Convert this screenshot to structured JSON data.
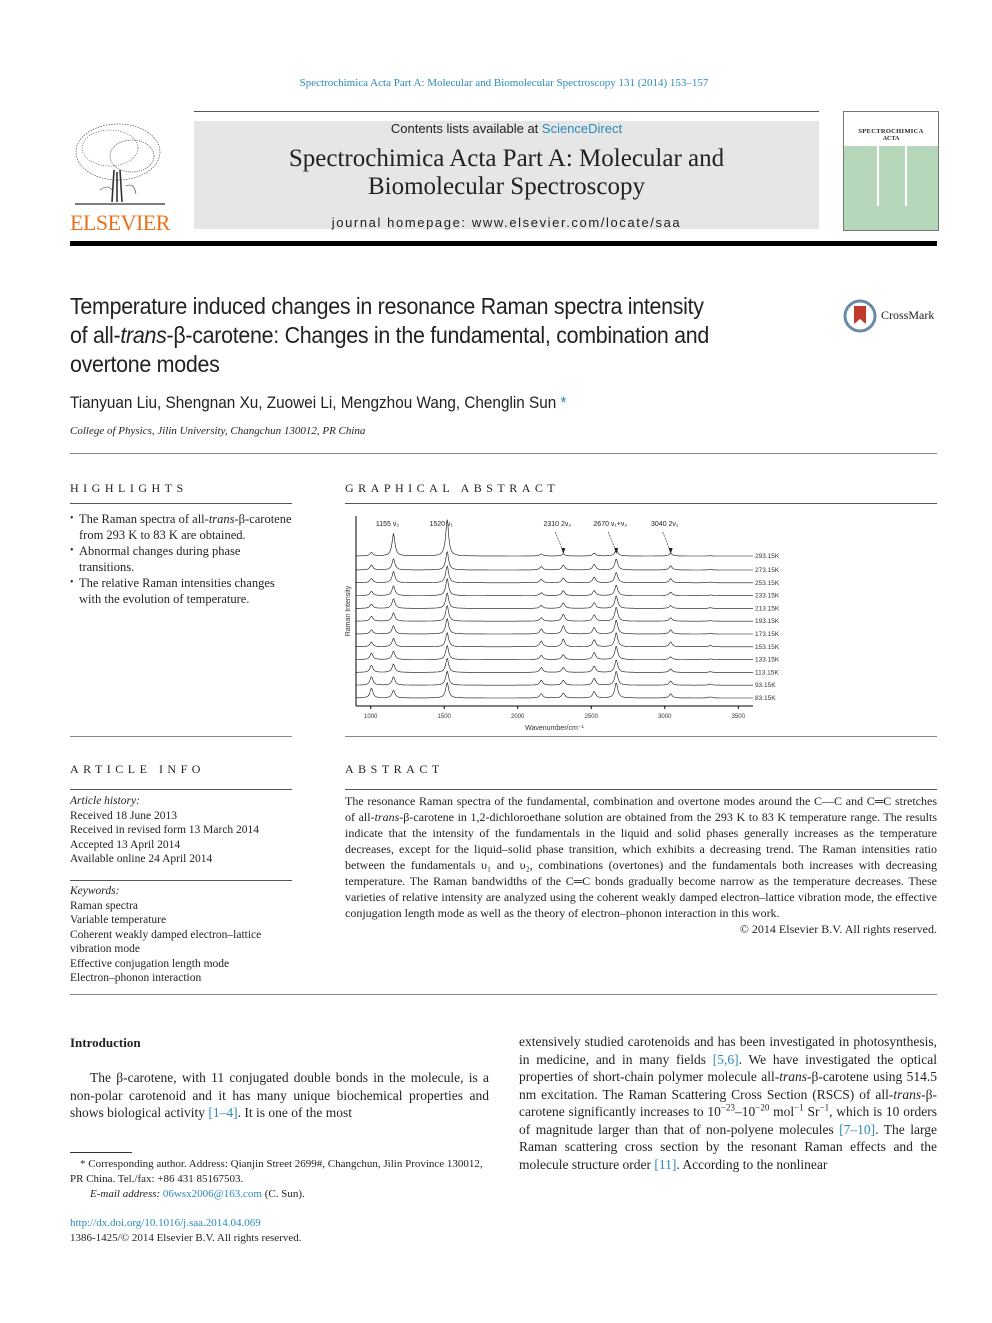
{
  "header": {
    "running_title": "Spectrochimica Acta Part A: Molecular and Biomolecular Spectroscopy 131 (2014) 153–157",
    "contents_prefix": "Contents lists available at ",
    "contents_link": "ScienceDirect",
    "journal_title_line1": "Spectrochimica Acta Part A: Molecular and",
    "journal_title_line2": "Biomolecular Spectroscopy",
    "homepage_label": "journal homepage: ",
    "homepage_url": "www.elsevier.com/locate/saa",
    "publisher_logo_text": "ELSEVIER",
    "cover_title1": "SPECTROCHIMICA",
    "cover_title2": "ACTA",
    "crossmark_label": "CrossMark"
  },
  "article": {
    "title_line1": "Temperature induced changes in resonance Raman spectra intensity",
    "title_line2_pre": "of all-",
    "title_line2_italic": "trans",
    "title_line2_post": "-β-carotene: Changes in the fundamental, combination and",
    "title_line3": "overtone modes",
    "authors": "Tianyuan Liu, Shengnan Xu, Zuowei Li, Mengzhou Wang, Chenglin Sun",
    "author_star": "*",
    "affiliation": "College of Physics, Jilin University, Changchun 130012, PR China"
  },
  "highlights": {
    "heading": "HIGHLIGHTS",
    "items": [
      {
        "pre": "The Raman spectra of all-",
        "italic": "trans",
        "post": "-β-carotene from 293 K to 83 K are obtained."
      },
      {
        "pre": "Abnormal changes during phase transitions.",
        "italic": "",
        "post": ""
      },
      {
        "pre": "The relative Raman intensities changes with the evolution of temperature.",
        "italic": "",
        "post": ""
      }
    ]
  },
  "graphical_abstract": {
    "heading": "GRAPHICAL ABSTRACT"
  },
  "chart_data": {
    "type": "line",
    "title": "",
    "xlabel": "Wavenumber/cm⁻¹",
    "ylabel": "Raman Intensity",
    "xlim": [
      900,
      3600
    ],
    "xticks": [
      1000,
      1500,
      2000,
      2500,
      3000,
      3500
    ],
    "grid": false,
    "peak_annotations": [
      {
        "x": 1155,
        "label": "1155  ν₂"
      },
      {
        "x": 1520,
        "label": "1520  ν₁"
      },
      {
        "x": 2310,
        "label": "2310  2ν₂"
      },
      {
        "x": 2670,
        "label": "2670  ν₁+ν₂"
      },
      {
        "x": 3040,
        "label": "3040  2ν₁"
      }
    ],
    "peaks": [
      1005,
      1155,
      1520,
      2160,
      2310,
      2520,
      2670,
      3040,
      3310
    ],
    "series": [
      {
        "name": "293.15K",
        "intensities": [
          0.25,
          1.6,
          2.6,
          0.15,
          0.15,
          0.2,
          0.45,
          0.2,
          0.02
        ]
      },
      {
        "name": "273.15K",
        "intensities": [
          0.35,
          0.8,
          1.3,
          0.25,
          0.35,
          0.4,
          0.8,
          0.3,
          0.05
        ]
      },
      {
        "name": "253.15K",
        "intensities": [
          0.3,
          0.8,
          1.2,
          0.25,
          0.35,
          0.4,
          0.75,
          0.3,
          0.05
        ]
      },
      {
        "name": "233.15K",
        "intensities": [
          0.3,
          0.7,
          1.2,
          0.2,
          0.35,
          0.35,
          0.75,
          0.25,
          0.05
        ]
      },
      {
        "name": "213.15K",
        "intensities": [
          0.3,
          0.7,
          1.1,
          0.2,
          0.4,
          0.4,
          0.9,
          0.2,
          0.05
        ]
      },
      {
        "name": "193.15K",
        "intensities": [
          0.35,
          0.6,
          1.1,
          0.25,
          0.5,
          0.45,
          1.0,
          0.25,
          0.05
        ]
      },
      {
        "name": "173.15K",
        "intensities": [
          0.3,
          0.6,
          1.1,
          0.35,
          0.6,
          0.45,
          1.0,
          0.3,
          0.05
        ]
      },
      {
        "name": "153.15K",
        "intensities": [
          0.35,
          0.6,
          1.0,
          0.4,
          0.55,
          0.5,
          1.0,
          0.35,
          0.1
        ]
      },
      {
        "name": "133.15K",
        "intensities": [
          0.45,
          0.6,
          1.0,
          0.3,
          0.35,
          0.5,
          0.95,
          0.2,
          0.05
        ]
      },
      {
        "name": "113.15K",
        "intensities": [
          0.5,
          0.6,
          1.0,
          0.35,
          0.35,
          0.45,
          0.9,
          0.25,
          0.05
        ]
      },
      {
        "name": "93.15K",
        "intensities": [
          0.6,
          0.6,
          1.0,
          0.35,
          0.35,
          0.5,
          1.0,
          0.3,
          0.08
        ]
      },
      {
        "name": "83.15K",
        "intensities": [
          0.7,
          0.55,
          1.1,
          0.3,
          0.35,
          0.45,
          1.1,
          0.3,
          0.08
        ]
      }
    ]
  },
  "article_info": {
    "heading": "ARTICLE INFO",
    "history_label": "Article history:",
    "history": [
      "Received 18 June 2013",
      "Received in revised form 13 March 2014",
      "Accepted 13 April 2014",
      "Available online 24 April 2014"
    ],
    "keywords_label": "Keywords:",
    "keywords": [
      "Raman spectra",
      "Variable temperature",
      "Coherent weakly damped electron–lattice vibration mode",
      "Effective conjugation length mode",
      "Electron–phonon interaction"
    ]
  },
  "abstract": {
    "heading": "ABSTRACT",
    "text": "The resonance Raman spectra of the fundamental, combination and overtone modes around the C—C and C═C stretches of all-trans-β-carotene in 1,2-dichloroethane solution are obtained from the 293 K to 83 K temperature range. The results indicate that the intensity of the fundamentals in the liquid and solid phases generally increases as the temperature decreases, except for the liquid–solid phase transition, which exhibits a decreasing trend. The Raman intensities ratio between the fundamentals υ₁ and υ₂, combinations (overtones) and the fundamentals both increases with decreasing temperature. The Raman bandwidths of the C═C bonds gradually become narrow as the temperature decreases. These varieties of relative intensity are analyzed using the coherent weakly damped electron–lattice vibration mode, the effective conjugation length mode as well as the theory of electron–phonon interaction in this work.",
    "rights": "© 2014 Elsevier B.V. All rights reserved."
  },
  "introduction": {
    "heading": "Introduction",
    "left_para": [
      {
        "t": "The β-carotene, with 11 conjugated double bonds in the molecule, is a non-polar carotenoid and it has many unique biochemical properties and shows biological activity "
      },
      {
        "ref": "[1–4]"
      },
      {
        "t": ". It is one of the most"
      }
    ],
    "right_para": [
      {
        "t": "extensively studied carotenoids and has been investigated in photosynthesis, in medicine, and in many fields "
      },
      {
        "ref": "[5,6]"
      },
      {
        "t": ". We have investigated the optical properties of short-chain polymer molecule all-"
      },
      {
        "i": "trans"
      },
      {
        "t": "-β-carotene using 514.5 nm excitation. The Raman Scattering Cross Section (RSCS) of all-"
      },
      {
        "i": "trans"
      },
      {
        "t": "-β-carotene significantly increases to 10"
      },
      {
        "sup": "−23"
      },
      {
        "t": "–10"
      },
      {
        "sup": "−20"
      },
      {
        "t": " mol"
      },
      {
        "sup": "−1"
      },
      {
        "t": " Sr"
      },
      {
        "sup": "−1"
      },
      {
        "t": ", which is 10 orders of magnitude larger than that of non-polyene molecules "
      },
      {
        "ref": "[7–10]"
      },
      {
        "t": ". The large Raman scattering cross section by the resonant Raman effects and the molecule structure order "
      },
      {
        "ref": "[11]"
      },
      {
        "t": ". According to the nonlinear"
      }
    ]
  },
  "footnotes": {
    "corresponding": "* Corresponding author. Address: Qianjin Street 2699#, Changchun, Jilin Province 130012, PR China. Tel./fax: +86 431 85167503.",
    "email_label": "E-mail address: ",
    "email": "06wsx2006@163.com",
    "email_suffix": " (C. Sun).",
    "doi": "http://dx.doi.org/10.1016/j.saa.2014.04.069",
    "issn": "1386-1425/© 2014 Elsevier B.V. All rights reserved."
  },
  "colors": {
    "link": "#2a8ab8",
    "elsevier_orange": "#e8721c",
    "banner_gray": "#e6e6e6",
    "cover_green": "#b7d7bb"
  }
}
